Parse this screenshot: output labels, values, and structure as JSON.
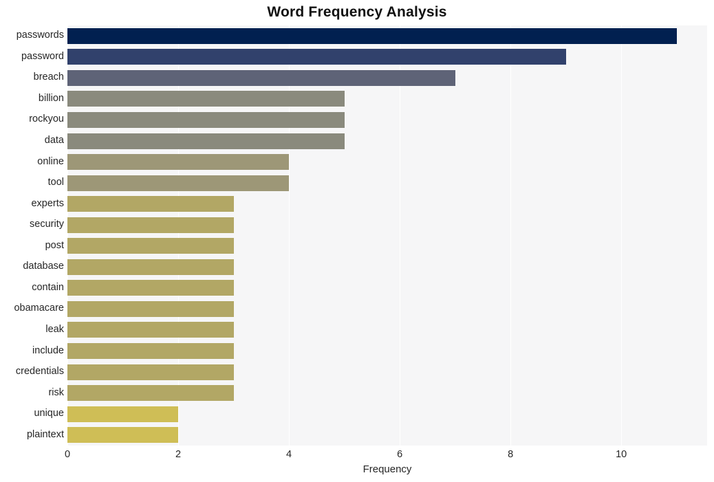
{
  "chart_data": {
    "type": "bar",
    "orientation": "horizontal",
    "title": "Word Frequency Analysis",
    "xlabel": "Frequency",
    "ylabel": "",
    "categories": [
      "passwords",
      "password",
      "breach",
      "billion",
      "rockyou",
      "data",
      "online",
      "tool",
      "experts",
      "security",
      "post",
      "database",
      "contain",
      "obamacare",
      "leak",
      "include",
      "credentials",
      "risk",
      "unique",
      "plaintext"
    ],
    "values": [
      11,
      9,
      7,
      5,
      5,
      5,
      4,
      4,
      3,
      3,
      3,
      3,
      3,
      3,
      3,
      3,
      3,
      3,
      2,
      2
    ],
    "colors": [
      "#012050",
      "#31416c",
      "#5e6377",
      "#8a8a7d",
      "#8a8a7d",
      "#8a8a7d",
      "#9d9777",
      "#9d9777",
      "#b2a765",
      "#b2a765",
      "#b2a765",
      "#b2a765",
      "#b2a765",
      "#b2a765",
      "#b2a765",
      "#b2a765",
      "#b2a765",
      "#b2a765",
      "#cfbe56",
      "#cfbe56"
    ],
    "xticks": [
      0,
      2,
      4,
      6,
      8,
      10
    ],
    "xlim": [
      0,
      11.55
    ],
    "grid": true,
    "legend": false,
    "plot_background": "#f6f6f7",
    "figure_background": "#ffffff",
    "gridline_color": "#ffffff"
  }
}
